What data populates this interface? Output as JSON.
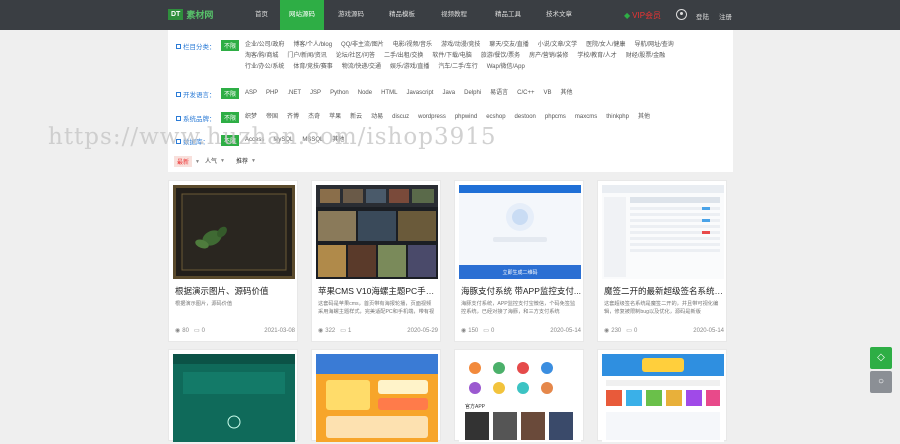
{
  "header": {
    "logo_badge": "DT",
    "logo_text": "素材网",
    "nav": [
      {
        "label": "首页",
        "active": false
      },
      {
        "label": "网站源码",
        "active": true
      },
      {
        "label": "游戏源码",
        "active": false
      },
      {
        "label": "精品模板",
        "active": false
      },
      {
        "label": "视频教程",
        "active": false
      },
      {
        "label": "精品工具",
        "active": false
      },
      {
        "label": "技术文章",
        "active": false
      }
    ],
    "vip_label": "VIP会员",
    "login": "登陆",
    "register": "注册"
  },
  "filters": {
    "all_label": "不限",
    "rows": [
      {
        "label": "栏目分类：",
        "options": [
          "企业/公司/政府",
          "博客/个人/blog",
          "QQ/非主流/图片",
          "电影/视频/音乐",
          "游戏/动漫/竞技",
          "聊天/交友/直播",
          "小说/文章/文学",
          "医院/女人/健康",
          "导航/网址/查询",
          "淘客/购/商城",
          "门户/新闻/资讯",
          "论坛/社区/问答",
          "二手/出租/交换",
          "软件/下载/电脑",
          "旅游/餐饮/票务",
          "房产/营销/装修",
          "学校/教育/人才",
          "财经/股票/金融",
          "行业/办公/系统",
          "体育/竞技/赛事",
          "物流/快递/交通",
          "娱乐/游戏/直播",
          "汽车/二手/车行",
          "Wap/微信/App"
        ]
      },
      {
        "label": "开发语言：",
        "options": [
          "ASP",
          "PHP",
          ".NET",
          "JSP",
          "Python",
          "Node",
          "HTML",
          "Javascript",
          "Java",
          "Delphi",
          "易语言",
          "C/C++",
          "VB",
          "其他"
        ]
      },
      {
        "label": "系统品牌：",
        "options": [
          "织梦",
          "帝国",
          "齐博",
          "杰奇",
          "苹果",
          "新云",
          "动易",
          "discuz",
          "wordpress",
          "phpwind",
          "ecshop",
          "destoon",
          "phpcms",
          "maxcms",
          "thinkphp",
          "其他"
        ]
      },
      {
        "label": "数据库：",
        "options": [
          "Access",
          "MySQL",
          "MSSQL",
          "其他"
        ]
      }
    ]
  },
  "sort": {
    "options": [
      "最新",
      "人气",
      "推荐"
    ],
    "active": 0
  },
  "watermark": "https://www.huzhan.com/ishop3915",
  "cards": [
    {
      "title": "根据演示图片、源码价值",
      "desc": "根据演示图片，源码价值",
      "views": "80",
      "comments": "0",
      "date": "2021-03-08"
    },
    {
      "title": "苹果CMS V10海螺主题PC手机...",
      "desc": "这套码是苹果cms，首页带有海报轮播，页面视频采用海螺主题样式，完美适配PC和手机端，带有视频播放",
      "views": "322",
      "comments": "1",
      "date": "2020-05-29"
    },
    {
      "title": "海豚支付系统 带APP监控支付...",
      "desc": "海豚支付系统，APP监控支付宝微信，个码免签监控系统，已经对接了海豚，和三方支付系统",
      "views": "150",
      "comments": "0",
      "date": "2020-05-14"
    },
    {
      "title": "魔签二开的最新超级签名系统+...",
      "desc": "这套超级签名系统是魔签二开的，并且带可视化编辑，修复被限制bug以及优化，源码是新版",
      "views": "230",
      "comments": "0",
      "date": "2020-05-14"
    }
  ],
  "thumb_texts": {
    "card3_app": "官方APP",
    "card3_btn": "立即生成二维码"
  },
  "colors": {
    "accent": "#2eae45",
    "topbar": "#3a3e43",
    "vip": "#e33333",
    "link_blue": "#2b7bd6"
  },
  "side_buttons": [
    {
      "icon": "gem-icon"
    },
    {
      "icon": "circle-icon"
    }
  ]
}
